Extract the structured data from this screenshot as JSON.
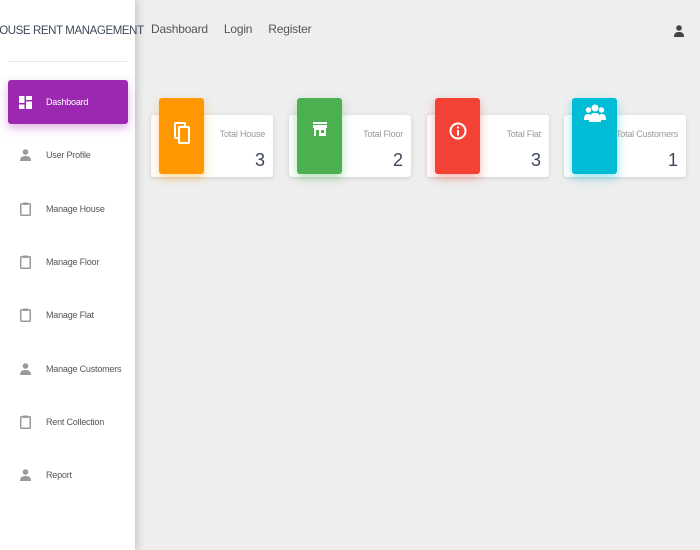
{
  "app": {
    "title": "HOUSE RENT MANAGEMENT"
  },
  "sidebar": {
    "items": [
      {
        "label": "Dashboard",
        "icon": "dashboard-icon"
      },
      {
        "label": "User Profile",
        "icon": "person-icon"
      },
      {
        "label": "Manage House",
        "icon": "clipboard-icon"
      },
      {
        "label": "Manage Floor",
        "icon": "clipboard-icon"
      },
      {
        "label": "Manage Flat",
        "icon": "clipboard-icon"
      },
      {
        "label": "Manage Customers",
        "icon": "person-icon"
      },
      {
        "label": "Rent Collection",
        "icon": "clipboard-icon"
      },
      {
        "label": "Report",
        "icon": "person-icon"
      }
    ],
    "active_index": 0
  },
  "topnav": {
    "links": [
      "Dashboard",
      "Login",
      "Register"
    ],
    "user_icon": "user-icon"
  },
  "cards": [
    {
      "title": "Total House",
      "value": "3",
      "color": "#ff9800",
      "icon": "copy-icon"
    },
    {
      "title": "Total Floor",
      "value": "2",
      "color": "#4caf50",
      "icon": "store-icon"
    },
    {
      "title": "Total Flat",
      "value": "3",
      "color": "#f44336",
      "icon": "info-icon"
    },
    {
      "title": "Total Customers",
      "value": "1",
      "color": "#00bcd4",
      "icon": "people-icon"
    }
  ],
  "colors": {
    "accent": "#9c27b0",
    "background": "#eeeeee"
  }
}
